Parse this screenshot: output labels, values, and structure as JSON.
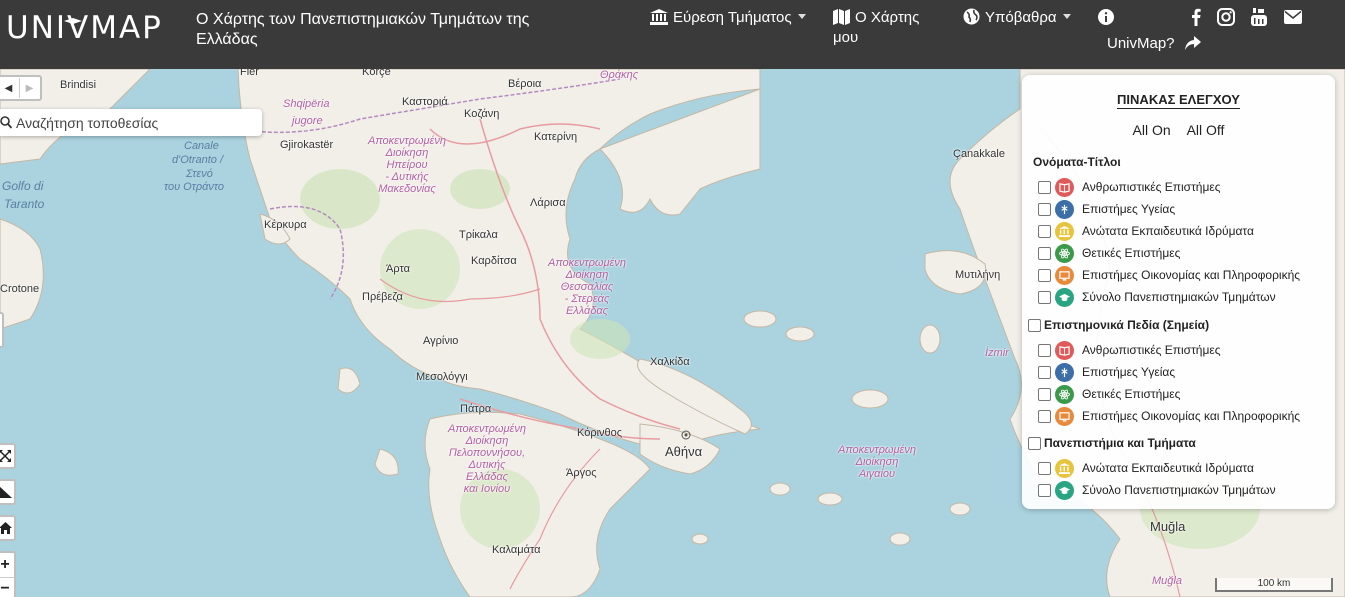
{
  "navbar": {
    "logo_text": "UNIVMAP",
    "site_title": "Ο Χάρτης των Πανεπιστημιακών Τμημάτων της Ελλάδας",
    "find_department": "Εύρεση Τμήματος",
    "my_map_line1": "Ο Χάρτης",
    "my_map_line2": "μου",
    "basemaps": "Υπόβαθρα",
    "about_line1": "UnivMap?",
    "colors": {
      "bg": "#3a3a3a",
      "text": "#ffffff"
    }
  },
  "search": {
    "placeholder": "Αναζήτηση τοποθεσίας"
  },
  "scale": {
    "label": "100 km"
  },
  "panel": {
    "title": "ΠΙΝΑΚΑΣ ΕΛΕΓΧΟΥ",
    "all_on": "All On",
    "all_off": "All Off",
    "sections": [
      {
        "heading": "Ονόματα-Τίτλοι",
        "items": [
          {
            "label": "Ανθρωπιστικές Επιστήμες",
            "icon": "book-icon",
            "color": "#e05a5a"
          },
          {
            "label": "Επιστήμες Υγείας",
            "icon": "health-icon",
            "color": "#3c6fa8"
          },
          {
            "label": "Ανώτατα Εκπαιδευτικά Ιδρύματα",
            "icon": "institution-icon",
            "color": "#e8c33c"
          },
          {
            "label": "Θετικές Επιστήμες",
            "icon": "atom-icon",
            "color": "#3a9a4a"
          },
          {
            "label": "Επιστήμες Οικονομίας και Πληροφορικής",
            "icon": "computer-icon",
            "color": "#e88a3c"
          },
          {
            "label": "Σύνολο Πανεπιστημιακών Τμημάτων",
            "icon": "graduation-cap-icon",
            "color": "#2aa584"
          }
        ]
      },
      {
        "heading": "Επιστημονικά Πεδία (Σημεία)",
        "items": [
          {
            "label": "Ανθρωπιστικές Επιστήμες",
            "icon": "book-icon",
            "color": "#e05a5a"
          },
          {
            "label": "Επιστήμες Υγείας",
            "icon": "health-icon",
            "color": "#3c6fa8"
          },
          {
            "label": "Θετικές Επιστήμες",
            "icon": "atom-icon",
            "color": "#3a9a4a"
          },
          {
            "label": "Επιστήμες Οικονομίας και Πληροφορικής",
            "icon": "computer-icon",
            "color": "#e88a3c"
          }
        ]
      },
      {
        "heading": "Πανεπιστήμια και Τμήματα",
        "items": [
          {
            "label": "Ανώτατα Εκπαιδευτικά Ιδρύματα",
            "icon": "institution-icon",
            "color": "#e8c33c"
          },
          {
            "label": "Σύνολο Πανεπιστημιακών Τμημάτων",
            "icon": "graduation-cap-icon",
            "color": "#2aa584"
          }
        ]
      }
    ]
  },
  "map_labels": {
    "fier": "Fier",
    "korce": "Korçe",
    "brindisi": "Brindisi",
    "kastoria": "Καστοριά",
    "kozani": "Κοζάνη",
    "veroia": "Βέροια",
    "thraki": "Θράκης",
    "katerini": "Κατερίνη",
    "shqiperia": "Shqipëria",
    "jugore": "jugore",
    "gjirokaster": "Gjirokastër",
    "canale": "Canale",
    "otranto": "d'Otranto /",
    "steno": "Στενό",
    "tou_otranto": "του Οτράντο",
    "golfo": "Golfo di",
    "taranto": "Taranto",
    "larisa": "Λάρισα",
    "kerkyra": "Κέρκυρα",
    "trikala": "Τρίκαλα",
    "karditsa": "Καρδίτσα",
    "arta": "Άρτα",
    "crotone": "Crotone",
    "preveza": "Πρέβεζα",
    "agrinio": "Αγρίνιο",
    "mesolongi": "Μεσολόγγι",
    "chalkida": "Χαλκίδα",
    "patra": "Πάτρα",
    "korinthos": "Κόρινθος",
    "athina": "Αθήνα",
    "argos": "Άργος",
    "kalamata": "Καλαμάτα",
    "mytilini": "Μυτιλήνη",
    "canakkale": "Çanakkale",
    "izmir": "İzmir",
    "mugla": "Muğla",
    "mugla2": "Muğla",
    "reg_ipeiros": "Αποκεντρωμένη\nΔιοίκηση\nΗπείρου\n- Δυτικής\nΜακεδονίας",
    "reg_thessalia": "Αποκεντρωμένη\nΔιοίκηση\nΘεσσαλίας\n- Στερεάς\nΕλλάδας",
    "reg_peloponnisos": "Αποκεντρωμένη\nΔιοίκηση\nΠελοποννήσου,\nΔυτικής\nΕλλάδας\nκαι Ιονίου",
    "reg_aigaiou": "Αποκεντρωμένη\nΔιοίκηση\nΑιγαίου"
  }
}
